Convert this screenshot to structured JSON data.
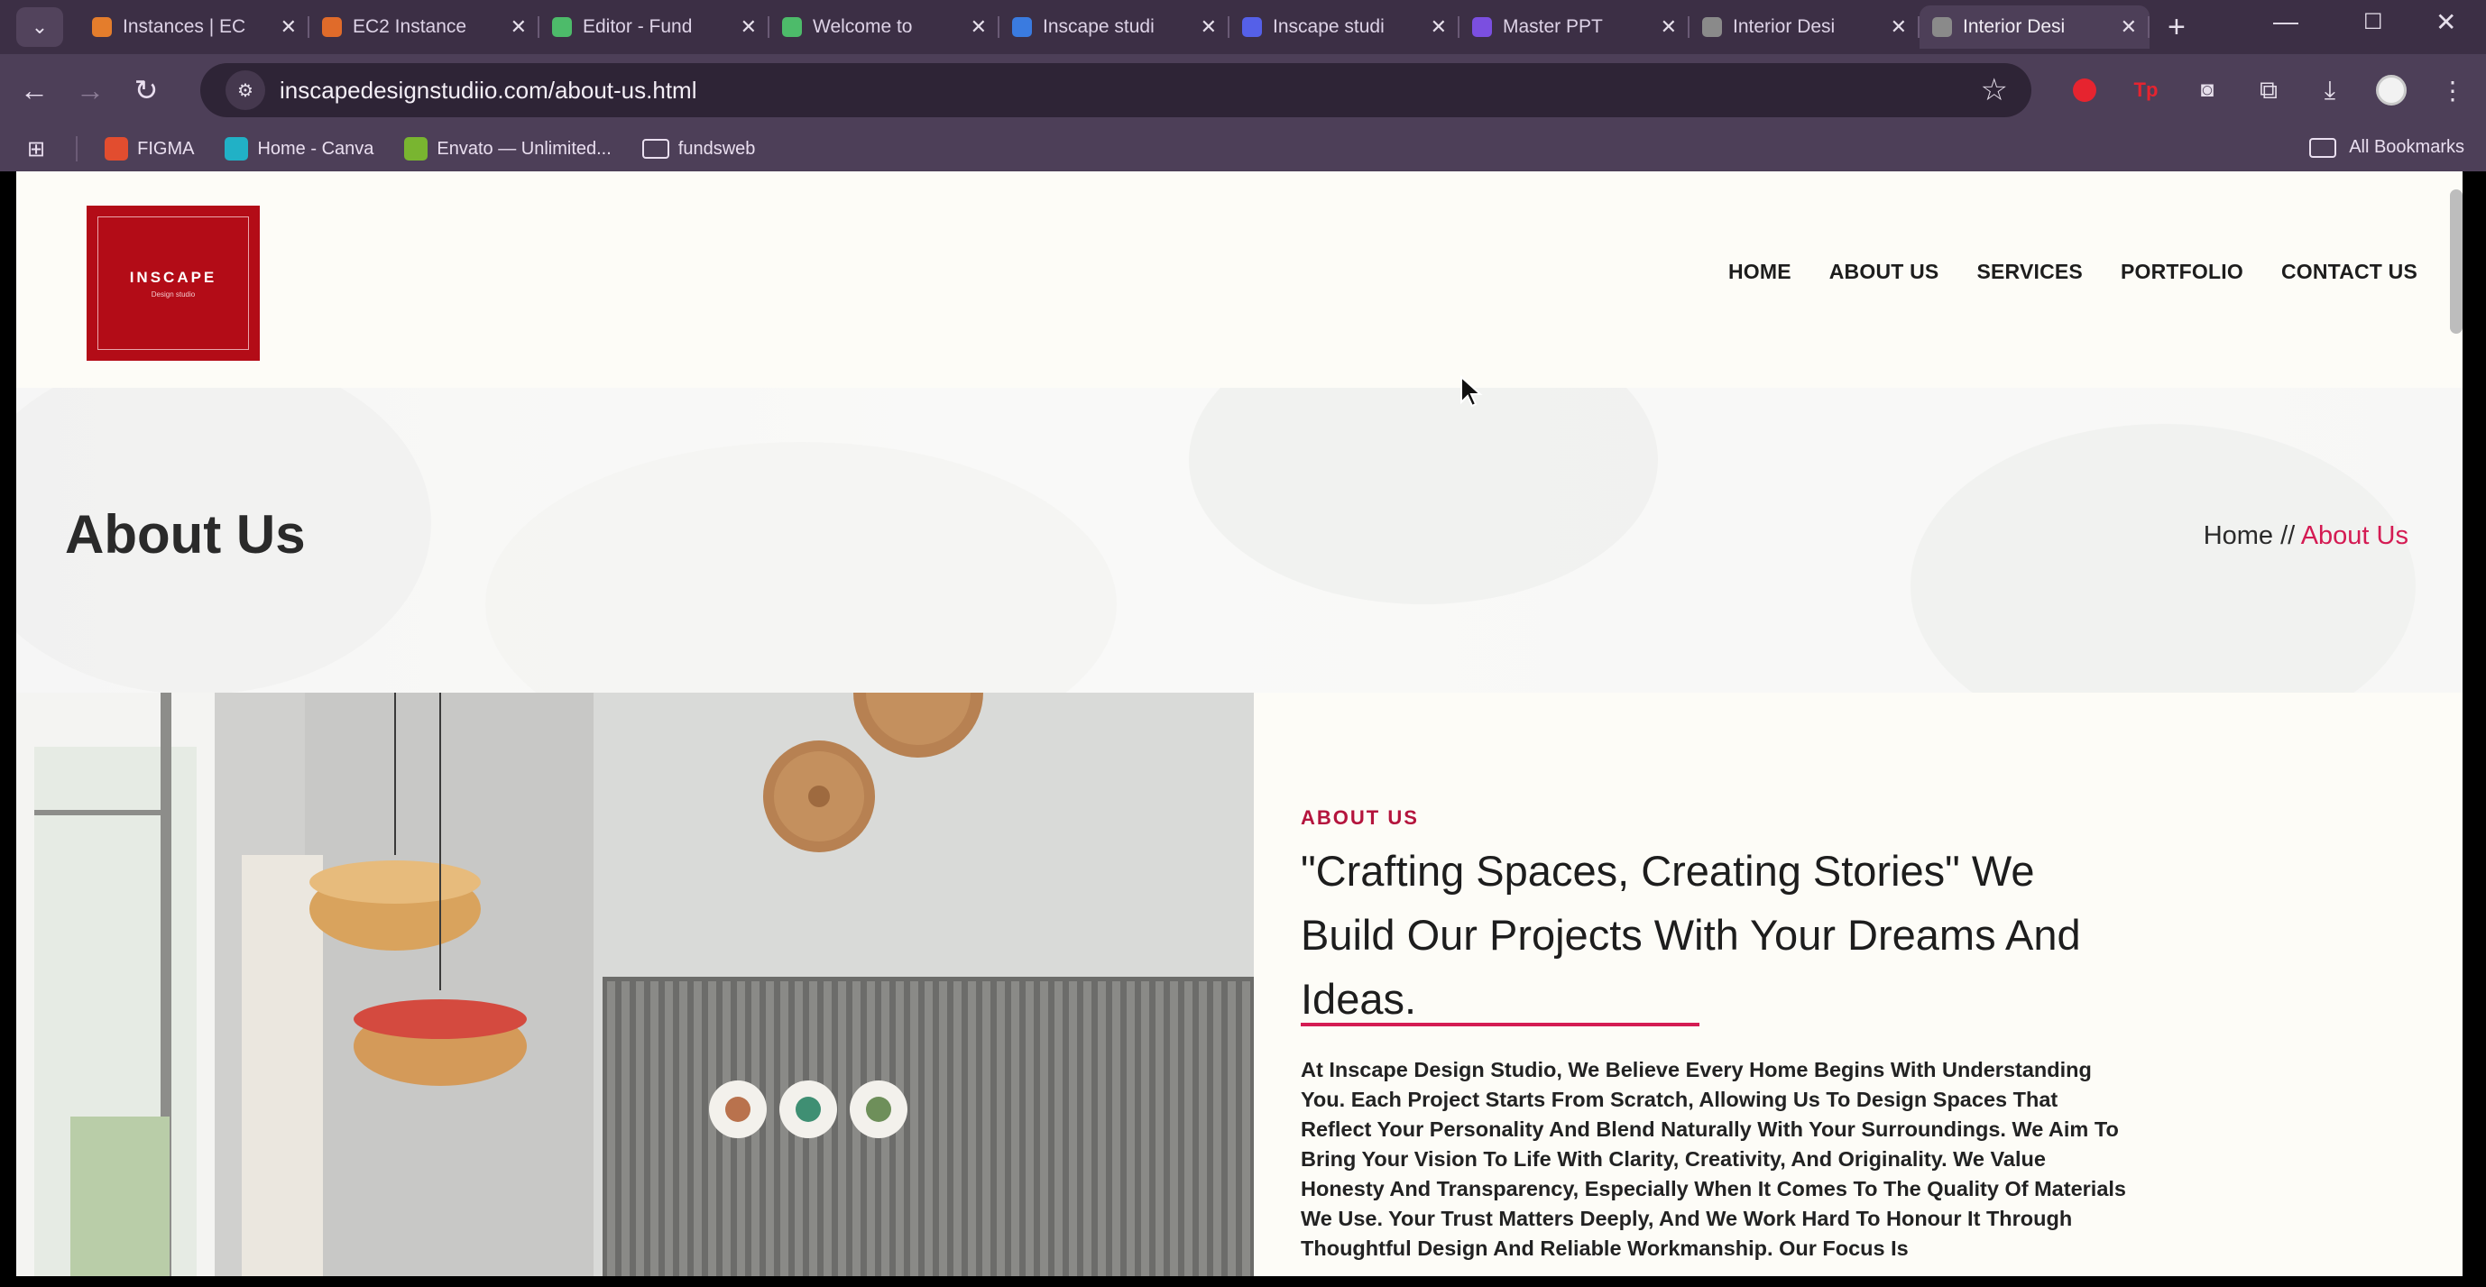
{
  "browser": {
    "tabs": [
      {
        "label": "Instances | EC",
        "color": "#e47d2c"
      },
      {
        "label": "EC2 Instance",
        "color": "#e06b2a"
      },
      {
        "label": "Editor - Fund",
        "color": "#4dbb6a"
      },
      {
        "label": "Welcome to",
        "color": "#4dbb6a"
      },
      {
        "label": "Inscape studi",
        "color": "#3a7be0"
      },
      {
        "label": "Inscape studi",
        "color": "#5560e8"
      },
      {
        "label": "Master PPT",
        "color": "#7b4fe0"
      },
      {
        "label": "Interior Desi",
        "color": "#8a8a8a"
      },
      {
        "label": "Interior Desi",
        "color": "#8a8a8a",
        "active": true
      }
    ],
    "url": "inscapedesignstudiio.com/about-us.html",
    "bookmarks": [
      {
        "label": "FIGMA",
        "color": "#e24d2f"
      },
      {
        "label": "Home - Canva",
        "color": "#21b1c6"
      },
      {
        "label": "Envato — Unlimited...",
        "color": "#79b530"
      },
      {
        "label": "fundsweb",
        "color": ""
      }
    ],
    "all_bookmarks": "All Bookmarks",
    "icons": [
      "back-icon",
      "forward-icon",
      "reload-icon",
      "site-info-icon",
      "star-icon",
      "extension-icon",
      "download-icon",
      "profile-icon",
      "menu-icon"
    ]
  },
  "site": {
    "logo": {
      "title": "INSCAPE",
      "sub": "Design studio"
    },
    "nav": [
      "HOME",
      "ABOUT US",
      "SERVICES",
      "PORTFOLIO",
      "CONTACT US"
    ],
    "banner": {
      "title": "About Us",
      "breadcrumb_home": "Home",
      "breadcrumb_sep": " // ",
      "breadcrumb_current": "About Us"
    },
    "about": {
      "eyebrow": "ABOUT US",
      "headline": "\"Crafting Spaces, Creating Stories\" We Build Our Projects With Your Dreams And Ideas.",
      "body": "At Inscape Design Studio, We Believe Every Home Begins With Understanding You. Each Project Starts From Scratch, Allowing Us To Design Spaces That Reflect Your Personality And Blend Naturally With Your Surroundings. We Aim To Bring Your Vision To Life With Clarity, Creativity, And Originality. We Value Honesty And Transparency, Especially When It Comes To The Quality Of Materials We Use. Your Trust Matters Deeply, And We Work Hard To Honour It Through Thoughtful Design And Reliable Workmanship. Our Focus Is"
    },
    "accent": "#d41b53"
  }
}
